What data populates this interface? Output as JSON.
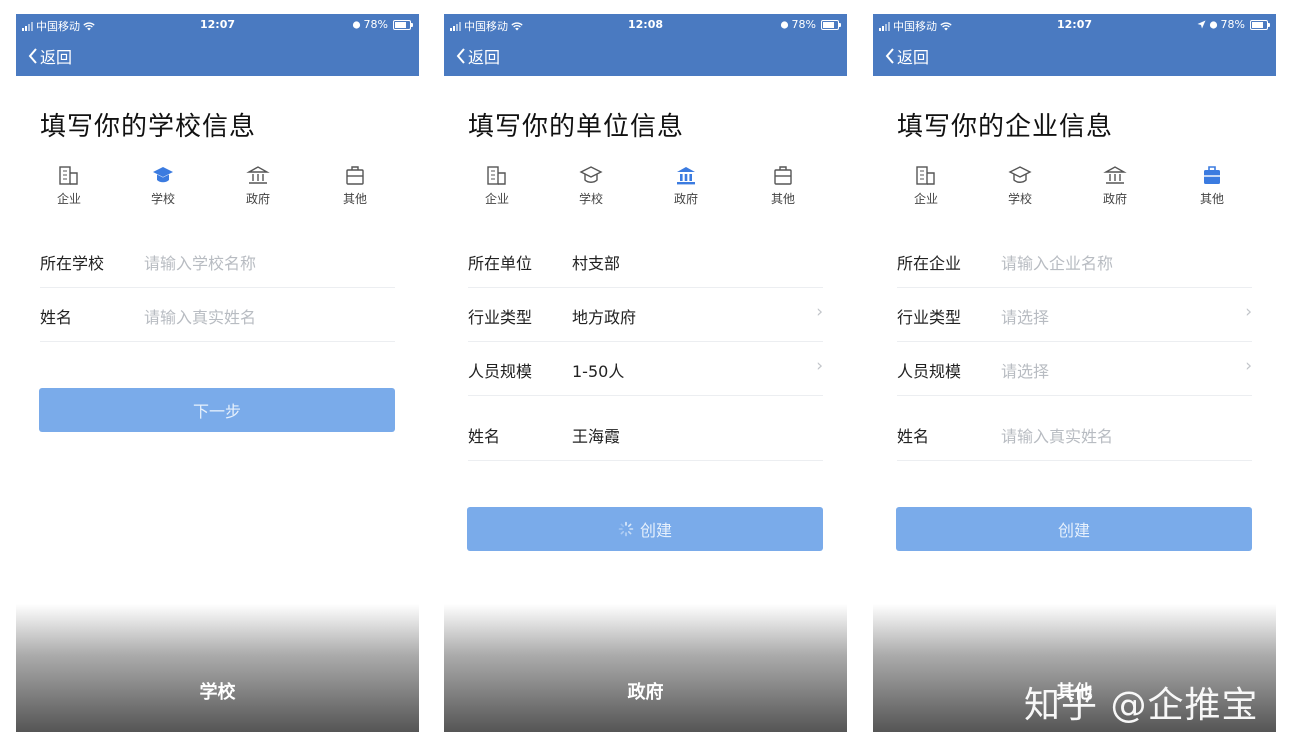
{
  "colors": {
    "nav": "#4a7ac1",
    "accent": "#3b7be0",
    "button": "#7aabea",
    "placeholder": "#b8bcc2"
  },
  "type_labels": [
    "企业",
    "学校",
    "政府",
    "其他"
  ],
  "screens": [
    {
      "status": {
        "carrier": "中国移动",
        "time": "12:07",
        "battery": "78%"
      },
      "back": "返回",
      "title": "填写你的学校信息",
      "selected_type": "学校",
      "fields": [
        {
          "label": "所在学校",
          "value": "",
          "placeholder": "请输入学校名称"
        },
        {
          "label": "姓名",
          "value": "",
          "placeholder": "请输入真实姓名"
        }
      ],
      "button": "下一步",
      "caption": "学校"
    },
    {
      "status": {
        "carrier": "中国移动",
        "time": "12:08",
        "battery": "78%"
      },
      "back": "返回",
      "title": "填写你的单位信息",
      "selected_type": "政府",
      "fields": [
        {
          "label": "所在单位",
          "value": "村支部"
        },
        {
          "label": "行业类型",
          "value": "地方政府",
          "arrow": "›"
        },
        {
          "label": "人员规模",
          "value": "1-50人",
          "arrow": "›"
        },
        {
          "label": "姓名",
          "value": "王海霞"
        }
      ],
      "button": "创建",
      "button_loading": true,
      "caption": "政府"
    },
    {
      "status": {
        "carrier": "中国移动",
        "time": "12:07",
        "battery": "78%"
      },
      "back": "返回",
      "title": "填写你的企业信息",
      "selected_type": "其他",
      "fields": [
        {
          "label": "所在企业",
          "value": "",
          "placeholder": "请输入企业名称"
        },
        {
          "label": "行业类型",
          "value": "",
          "placeholder": "请选择",
          "arrow": "›"
        },
        {
          "label": "人员规模",
          "value": "",
          "placeholder": "请选择",
          "arrow": "›"
        },
        {
          "label": "姓名",
          "value": "",
          "placeholder": "请输入真实姓名"
        }
      ],
      "button": "创建",
      "caption": "其他"
    }
  ],
  "watermark": "知乎 @企推宝"
}
